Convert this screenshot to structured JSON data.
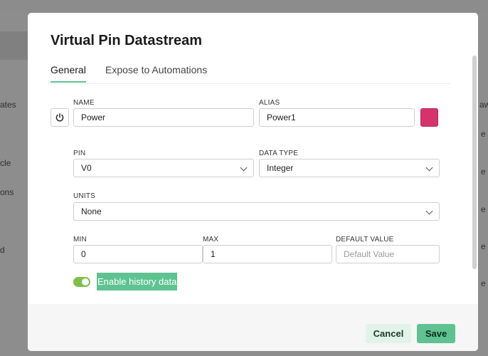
{
  "background": {
    "left_items": [
      "ates",
      "cle",
      "ons",
      "d"
    ],
    "right_items": [
      "aw",
      "e",
      "e",
      "e",
      "e",
      "e"
    ]
  },
  "modal": {
    "title": "Virtual Pin Datastream",
    "tabs": [
      {
        "label": "General",
        "active": true
      },
      {
        "label": "Expose to Automations",
        "active": false
      }
    ],
    "power_icon": "power-icon",
    "name": {
      "label": "NAME",
      "value": "Power"
    },
    "alias": {
      "label": "ALIAS",
      "value": "Power1"
    },
    "color": "#d6336c",
    "pin": {
      "label": "PIN",
      "value": "V0"
    },
    "data_type": {
      "label": "DATA TYPE",
      "value": "Integer"
    },
    "units": {
      "label": "UNITS",
      "value": "None"
    },
    "min": {
      "label": "MIN",
      "value": "0"
    },
    "max": {
      "label": "MAX",
      "value": "1"
    },
    "default_value": {
      "label": "DEFAULT VALUE",
      "value": "",
      "placeholder": "Default Value"
    },
    "history": {
      "label": "Enable history data",
      "enabled": true
    }
  },
  "footer": {
    "cancel_label": "Cancel",
    "save_label": "Save"
  },
  "colors": {
    "accent": "#5ec391",
    "toggle_on": "#7cc04b",
    "swatch": "#d6336c"
  }
}
